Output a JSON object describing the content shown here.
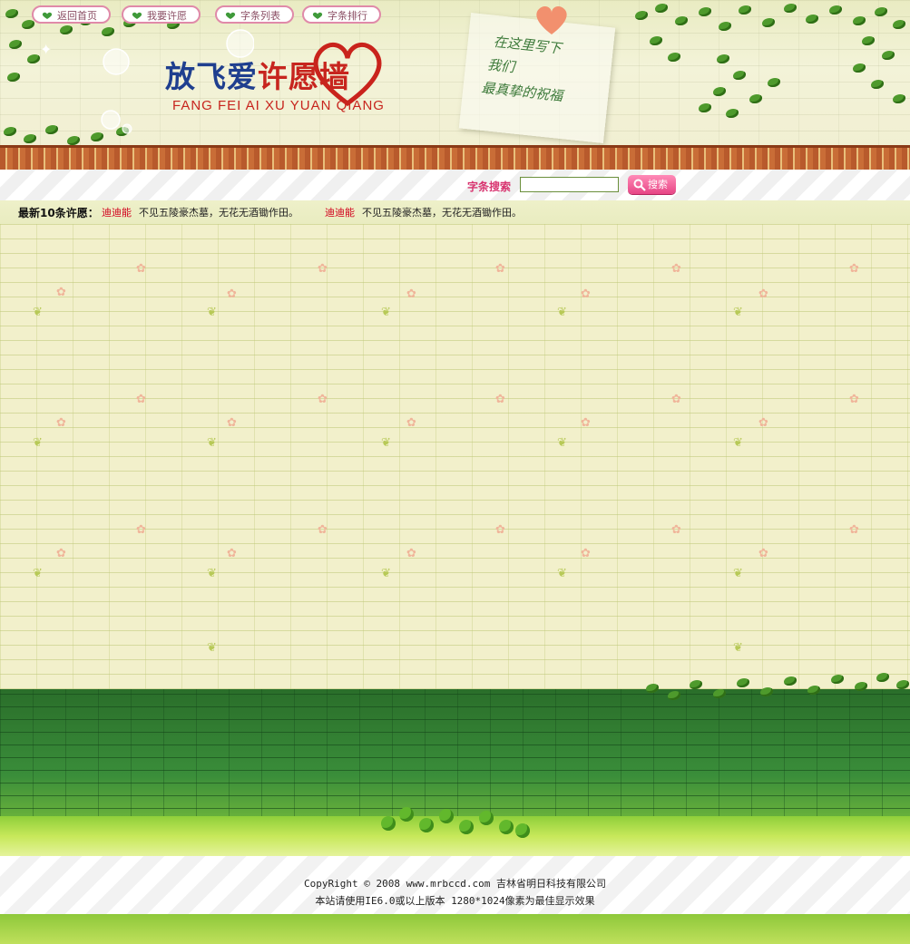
{
  "header": {
    "logo_title_part1": "放飞爱",
    "logo_title_part2": "许愿墙",
    "logo_subtitle": "FANG  FEI  AI  XU  YUAN  QIANG",
    "note_lines": [
      "在这里写下",
      "我们",
      "最真挚的祝福"
    ]
  },
  "nav": {
    "items": [
      {
        "label": "返回首页"
      },
      {
        "label": "我要许愿"
      },
      {
        "label": "字条列表"
      },
      {
        "label": "字条排行"
      }
    ]
  },
  "search": {
    "label": "字条搜索",
    "value": "",
    "button_label": "搜索"
  },
  "ticker": {
    "label": "最新10条许愿：",
    "items": [
      {
        "name": "迪迪能",
        "text": "不见五陵豪杰墓，无花无酒锄作田。"
      },
      {
        "name": "迪迪能",
        "text": "不见五陵豪杰墓，无花无酒锄作田。"
      }
    ]
  },
  "footer": {
    "copyright": "CopyRight © 2008 www.mrbccd.com 吉林省明日科技有限公司",
    "notice": "本站请使用IE6.0或以上版本 1280*1024像素为最佳显示效果"
  },
  "colors": {
    "accent_pink": "#d8336f",
    "logo_blue": "#1f3f8f",
    "logo_red": "#c7251e",
    "ticker_name_red": "#d1001c"
  }
}
